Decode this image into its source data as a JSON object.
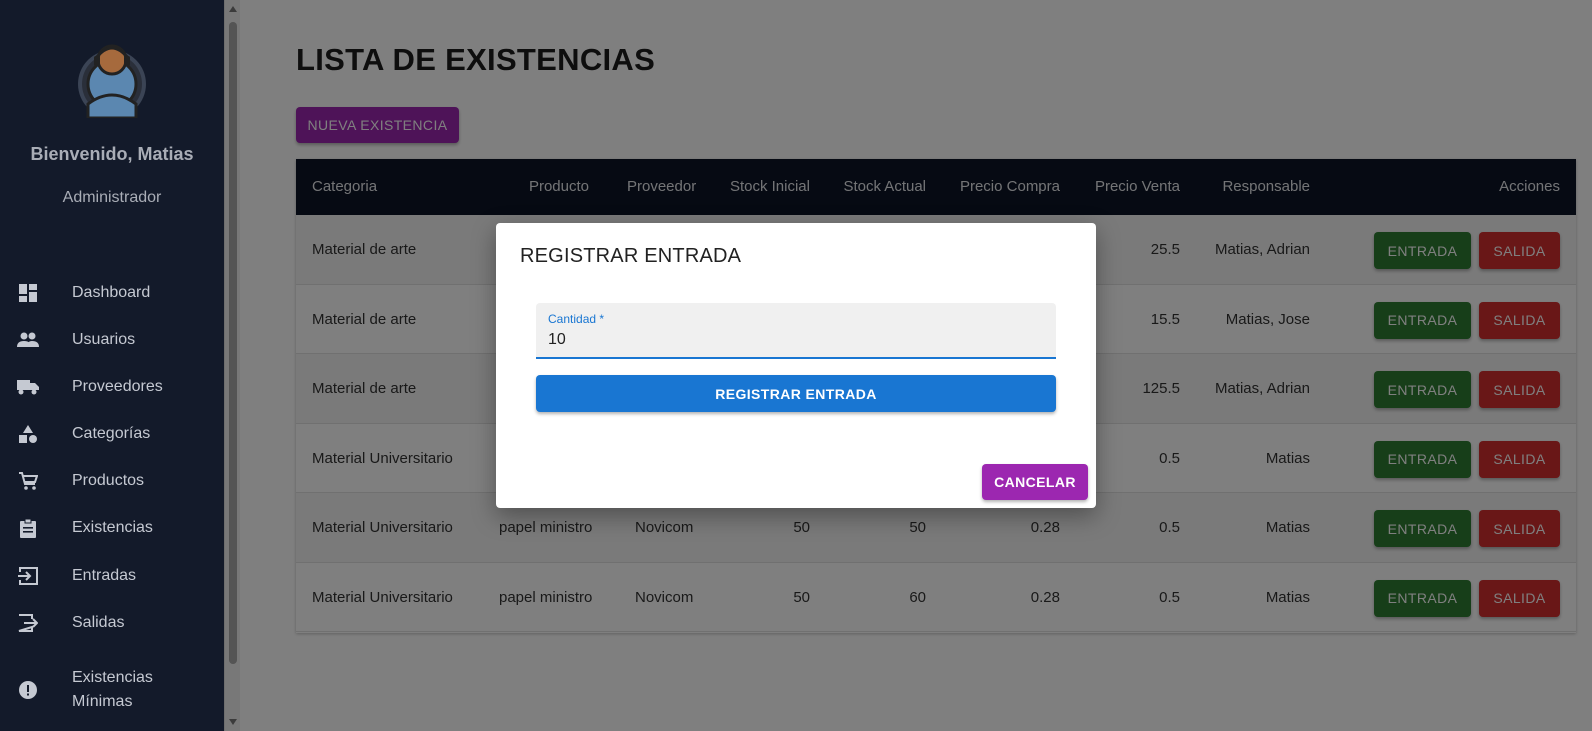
{
  "sidebar": {
    "welcome": "Bienvenido, Matias",
    "role": "Administrador",
    "items": [
      {
        "label": "Dashboard",
        "icon": "dashboard-icon"
      },
      {
        "label": "Usuarios",
        "icon": "users-icon"
      },
      {
        "label": "Proveedores",
        "icon": "truck-icon"
      },
      {
        "label": "Categorías",
        "icon": "category-icon"
      },
      {
        "label": "Productos",
        "icon": "cart-icon"
      },
      {
        "label": "Existencias",
        "icon": "clipboard-icon"
      },
      {
        "label": "Entradas",
        "icon": "login-icon"
      },
      {
        "label": "Salidas",
        "icon": "logout-icon"
      },
      {
        "label": "Existencias Mínimas",
        "icon": "alert-icon"
      }
    ]
  },
  "main": {
    "title": "LISTA DE EXISTENCIAS",
    "new_button": "NUEVA EXISTENCIA",
    "table": {
      "headers": [
        "Categoria",
        "Producto",
        "Proveedor",
        "Stock Inicial",
        "Stock Actual",
        "Precio Compra",
        "Precio Venta",
        "Responsable",
        "Acciones"
      ],
      "rows": [
        {
          "categoria": "Material de arte",
          "producto": "",
          "proveedor": "",
          "stock_inicial": "",
          "stock_actual": "",
          "precio_compra": "",
          "precio_venta": "25.5",
          "responsable": "Matias, Adrian"
        },
        {
          "categoria": "Material de arte",
          "producto": "",
          "proveedor": "",
          "stock_inicial": "",
          "stock_actual": "",
          "precio_compra": "",
          "precio_venta": "15.5",
          "responsable": "Matias, Jose"
        },
        {
          "categoria": "Material de arte",
          "producto": "",
          "proveedor": "",
          "stock_inicial": "",
          "stock_actual": "",
          "precio_compra": "",
          "precio_venta": "125.5",
          "responsable": "Matias, Adrian"
        },
        {
          "categoria": "Material Universitario",
          "producto": "",
          "proveedor": "",
          "stock_inicial": "",
          "stock_actual": "",
          "precio_compra": "",
          "precio_venta": "0.5",
          "responsable": "Matias"
        },
        {
          "categoria": "Material Universitario",
          "producto": "papel ministro",
          "proveedor": "Novicom",
          "stock_inicial": "50",
          "stock_actual": "50",
          "precio_compra": "0.28",
          "precio_venta": "0.5",
          "responsable": "Matias"
        },
        {
          "categoria": "Material Universitario",
          "producto": "papel ministro",
          "proveedor": "Novicom",
          "stock_inicial": "50",
          "stock_actual": "60",
          "precio_compra": "0.28",
          "precio_venta": "0.5",
          "responsable": "Matias"
        }
      ],
      "entrada_label": "ENTRADA",
      "salida_label": "SALIDA"
    }
  },
  "dialog": {
    "title": "REGISTRAR ENTRADA",
    "field_label": "Cantidad *",
    "field_value": "10",
    "submit_label": "REGISTRAR ENTRADA",
    "cancel_label": "CANCELAR"
  },
  "colors": {
    "sidebar_bg": "#131a2a",
    "header_bg": "#0d1526",
    "primary": "#1976d2",
    "secondary": "#9c27b0",
    "success": "#2e7d32",
    "error": "#d32f2f"
  }
}
